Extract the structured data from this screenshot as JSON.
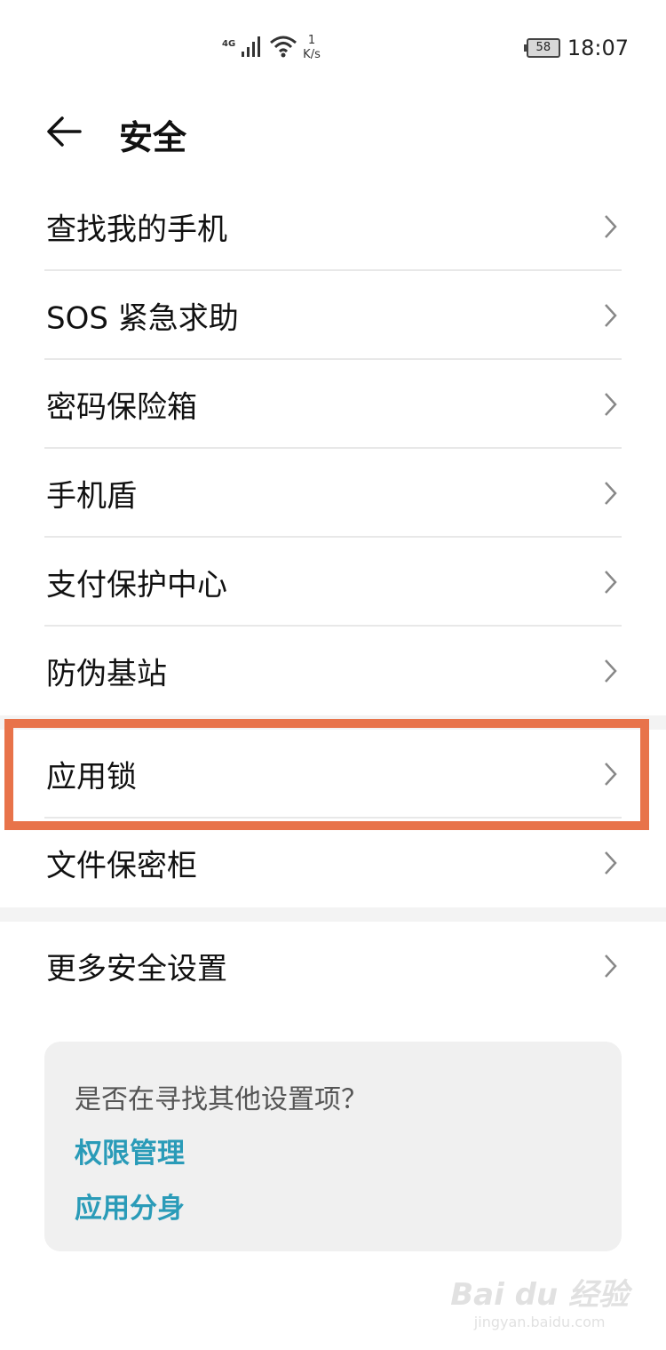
{
  "status_bar": {
    "network": "4G",
    "speed_value": "1",
    "speed_unit": "K/s",
    "battery": "58",
    "time": "18:07"
  },
  "header": {
    "title": "安全"
  },
  "group1": [
    {
      "label": "查找我的手机"
    },
    {
      "label": "SOS 紧急求助"
    },
    {
      "label": "密码保险箱"
    },
    {
      "label": "手机盾"
    },
    {
      "label": "支付保护中心"
    },
    {
      "label": "防伪基站"
    }
  ],
  "group2": [
    {
      "label": "应用锁",
      "highlighted": true
    },
    {
      "label": "文件保密柜"
    }
  ],
  "group3": [
    {
      "label": "更多安全设置"
    }
  ],
  "suggest": {
    "title": "是否在寻找其他设置项？",
    "links": [
      "权限管理",
      "应用分身"
    ],
    "link_color": "#2a9bb8"
  },
  "highlight_color": "#e8734a",
  "watermark": {
    "logo": "Bai du 经验",
    "url": "jingyan.baidu.com"
  }
}
